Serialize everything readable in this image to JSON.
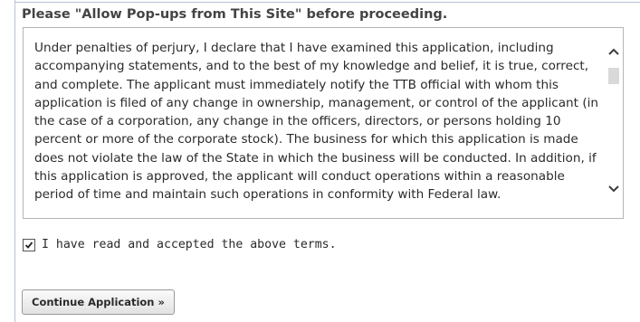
{
  "notice": {
    "popup_text": "Please \"Allow Pop-ups from This Site\" before proceeding."
  },
  "terms": {
    "text": "Under penalties of perjury, I declare that I have examined this application, including accompanying statements, and to the best of my knowledge and belief, it is true, correct, and complete. The applicant must immediately notify the TTB official with whom this application is filed of any change in ownership, management, or control of the applicant (in the case of a corporation, any change in the officers, directors, or persons holding 10 percent or more of the corporate stock). The business for which this application is made does not violate the law of the State in which the business will be conducted. In addition, if this application is approved, the applicant will conduct operations within a reasonable period of time and maintain such operations in conformity with Federal law."
  },
  "agreement": {
    "checked": true,
    "label": "I have read and accepted the above terms."
  },
  "actions": {
    "continue_label": "Continue Application »"
  }
}
